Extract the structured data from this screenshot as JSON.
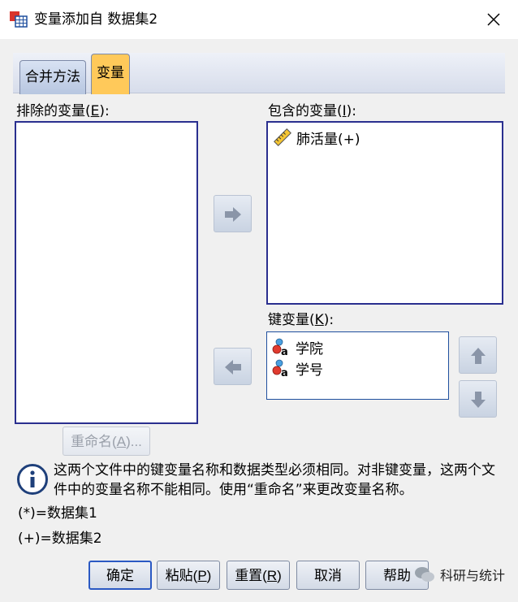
{
  "window": {
    "title": "变量添加自 数据集2"
  },
  "tabs": [
    {
      "label": "合并方法"
    },
    {
      "label": "变量"
    }
  ],
  "excluded": {
    "label_prefix": "排除的变量(",
    "label_key": "E",
    "label_suffix": "):",
    "items": []
  },
  "included": {
    "label_prefix": "包含的变量(",
    "label_key": "I",
    "label_suffix": "):",
    "items": [
      {
        "name": "肺活量(+)",
        "icon": "scale-ruler-icon"
      }
    ]
  },
  "key": {
    "label_prefix": "键变量(",
    "label_key": "K",
    "label_suffix": "):",
    "items": [
      {
        "name": "学院",
        "icon": "nominal-string-icon"
      },
      {
        "name": "学号",
        "icon": "nominal-string-icon"
      }
    ]
  },
  "rename": {
    "label_prefix": "重命名(",
    "label_key": "A",
    "label_suffix": ")..."
  },
  "info": {
    "text": "这两个文件中的键变量名称和数据类型必须相同。对非键变量，这两个文件中的变量名称不能相同。使用“重命名”来更改变量名称。"
  },
  "legend": {
    "star": "(*)=数据集1",
    "plus": "(+)=数据集2"
  },
  "buttons": {
    "ok": "确定",
    "paste": {
      "prefix": "粘贴(",
      "key": "P",
      "suffix": ")"
    },
    "reset": {
      "prefix": "重置(",
      "key": "R",
      "suffix": ")"
    },
    "cancel": "取消",
    "help": "帮助"
  },
  "watermark": {
    "text": "科研与统计"
  }
}
